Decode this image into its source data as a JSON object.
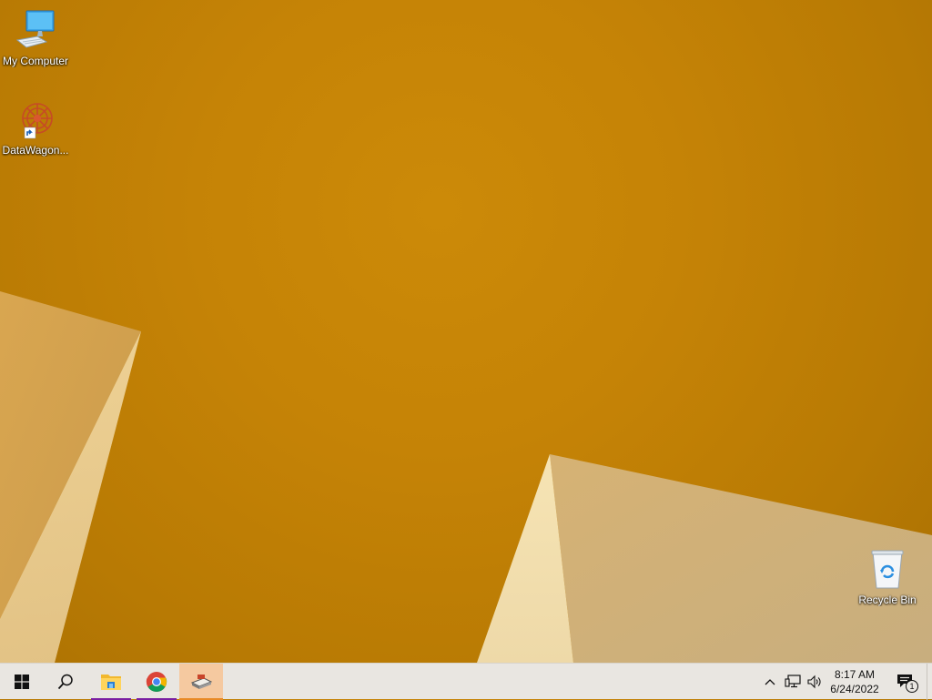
{
  "desktop": {
    "icons": [
      {
        "label": "My Computer",
        "icon": "computer-icon"
      },
      {
        "label": "DataWagon...",
        "icon": "datawagon-shortcut-icon"
      },
      {
        "label": "Recycle Bin",
        "icon": "recycle-bin-icon"
      }
    ]
  },
  "taskbar": {
    "start_icon": "windows-start-icon",
    "search_icon": "search-icon",
    "apps": [
      {
        "icon": "file-explorer-icon",
        "state": "running"
      },
      {
        "icon": "chrome-icon",
        "state": "running"
      },
      {
        "icon": "datawagon-app-icon",
        "state": "active"
      }
    ],
    "tray": {
      "icons": [
        "chevron-up-icon",
        "network-icon",
        "volume-icon"
      ],
      "time": "8:17 AM",
      "date": "6/24/2022",
      "notification_count": "1"
    }
  },
  "colors": {
    "wallpaper": "#c58306",
    "taskbar": "#e9e6e1",
    "active_app": "#f5c9a0",
    "running_indicator": "#7a1fa2"
  }
}
